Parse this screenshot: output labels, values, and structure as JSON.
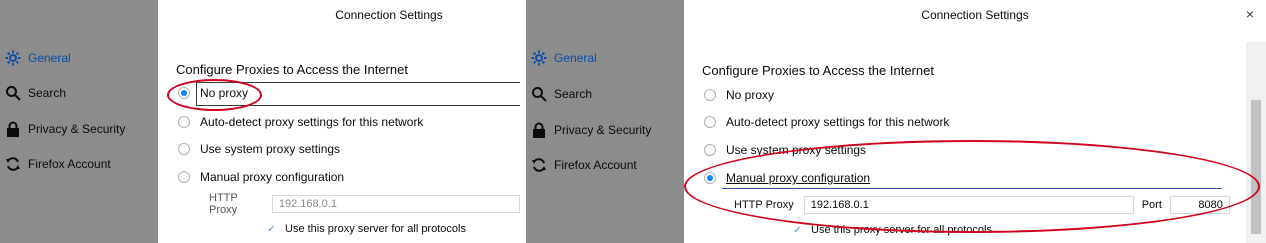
{
  "dialog": {
    "title": "Connection Settings",
    "heading": "Configure Proxies to Access the Internet",
    "close_glyph": "×"
  },
  "sidebar": {
    "items": [
      {
        "label": "General",
        "icon": "gear-icon"
      },
      {
        "label": "Search",
        "icon": "search-icon"
      },
      {
        "label": "Privacy & Security",
        "icon": "lock-icon"
      },
      {
        "label": "Firefox Account",
        "icon": "sync-icon"
      }
    ]
  },
  "options": {
    "no_proxy": "No proxy",
    "auto_detect": "Auto-detect proxy settings for this network",
    "system": "Use system proxy settings",
    "manual": "Manual proxy configuration"
  },
  "http_proxy": {
    "label": "HTTP Proxy",
    "value": "192.168.0.1",
    "port_label": "Port",
    "port_value": "8080"
  },
  "use_all_protocols": "Use this proxy server for all protocols",
  "colors": {
    "accent": "#0a84ff",
    "annotation": "#d0021b",
    "sidebar_bg": "#8c8c8c"
  }
}
